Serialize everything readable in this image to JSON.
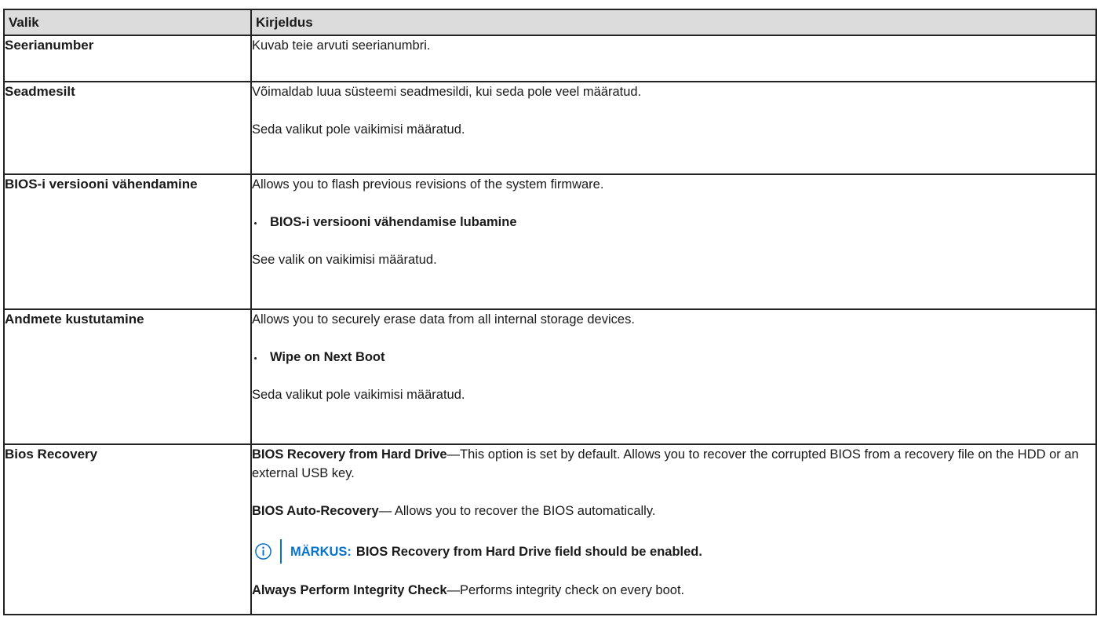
{
  "table": {
    "header": {
      "col1": "Valik",
      "col2": "Kirjeldus"
    },
    "rows": [
      {
        "name": "Seerianumber",
        "desc": [
          "Kuvab teie arvuti seerianumbri."
        ]
      },
      {
        "name": "Seadmesilt",
        "desc": [
          "Võimaldab luua süsteemi seadmesildi, kui seda pole veel määratud.",
          "Seda valikut pole vaikimisi määratud."
        ]
      },
      {
        "name": "BIOS-i versiooni vähendamine",
        "intro": "Allows you to flash previous revisions of the system firmware.",
        "bullet": "BIOS-i versiooni vähendamise lubamine",
        "outro": "See valik on vaikimisi määratud."
      },
      {
        "name": "Andmete kustutamine",
        "intro": "Allows you to securely erase data from all internal storage devices.",
        "bullet": "Wipe on Next Boot",
        "outro": "Seda valikut pole vaikimisi määratud."
      },
      {
        "name": "Bios Recovery",
        "p1_bold": "BIOS Recovery from Hard Drive",
        "p1_text": "—This option is set by default. Allows you to recover the corrupted BIOS from a recovery file on the HDD or an external USB key.",
        "p2_bold": "BIOS Auto-Recovery",
        "p2_text": "— Allows you to recover the BIOS automatically.",
        "note_label": "MÄRKUS:",
        "note_text": "BIOS Recovery from Hard Drive field should be enabled.",
        "p3_bold": "Always Perform Integrity Check",
        "p3_text": "—Performs integrity check on every boot."
      }
    ]
  },
  "icons": {
    "note": "info-circle-icon"
  },
  "colors": {
    "accent": "#0672cb",
    "header_bg": "#dcdcdc",
    "border": "#222222"
  }
}
